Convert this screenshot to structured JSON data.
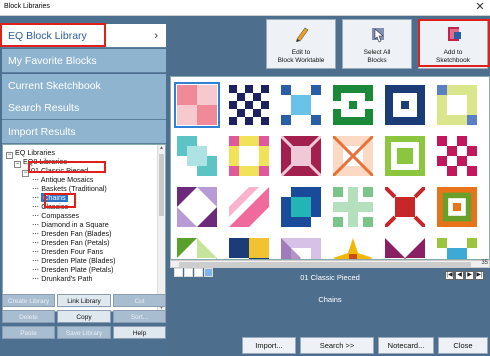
{
  "window": {
    "title": "Block Libraries",
    "close": "✕"
  },
  "nav": [
    {
      "label": "EQ Block Library",
      "chev": "›"
    },
    {
      "label": "My Favorite Blocks"
    },
    {
      "label": "Current Sketchbook"
    },
    {
      "label": "Search Results"
    },
    {
      "label": "Import Results"
    }
  ],
  "tree": [
    {
      "label": "EQ Libraries",
      "tog": "−"
    },
    {
      "label": "EQ8 Libraries",
      "tog": "−"
    },
    {
      "label": "01 Classic Pieced",
      "tog": "−"
    },
    {
      "label": "Antique Mosaics"
    },
    {
      "label": "Baskets (Traditional)"
    },
    {
      "label": "Chains"
    },
    {
      "label": "Classics"
    },
    {
      "label": "Compasses"
    },
    {
      "label": "Diamond in a Square"
    },
    {
      "label": "Dresden Fan (Blades)"
    },
    {
      "label": "Dresden Fan (Petals)"
    },
    {
      "label": "Dresden Four Fans"
    },
    {
      "label": "Dresden Plate (Blades)"
    },
    {
      "label": "Dresden Plate (Petals)"
    },
    {
      "label": "Drunkard's Path"
    }
  ],
  "lib_buttons": {
    "create": "Create Library",
    "link": "Link Library",
    "cut": "Cut",
    "delete": "Delete",
    "copy": "Copy",
    "sort": "Sort...",
    "paste": "Paste",
    "save": "Save Library",
    "help": "Help"
  },
  "toolbar": {
    "edit": "Edit to\nBlock Worktable",
    "select_all": "Select All\nBlocks",
    "add": "Add to\nSketchbook"
  },
  "status": {
    "library": "01 Classic Pieced",
    "category": "Chains",
    "scroll_num": "35"
  },
  "pager": [
    "|◀",
    "◀",
    "▶",
    "▶|"
  ],
  "bottom": {
    "import": "Import...",
    "search": "Search  >>",
    "notecard": "Notecard...",
    "close": "Close"
  },
  "colors": {
    "accent": "#2a5d9a",
    "highlight": "#e0201a",
    "panel": "#4e6e8e"
  }
}
